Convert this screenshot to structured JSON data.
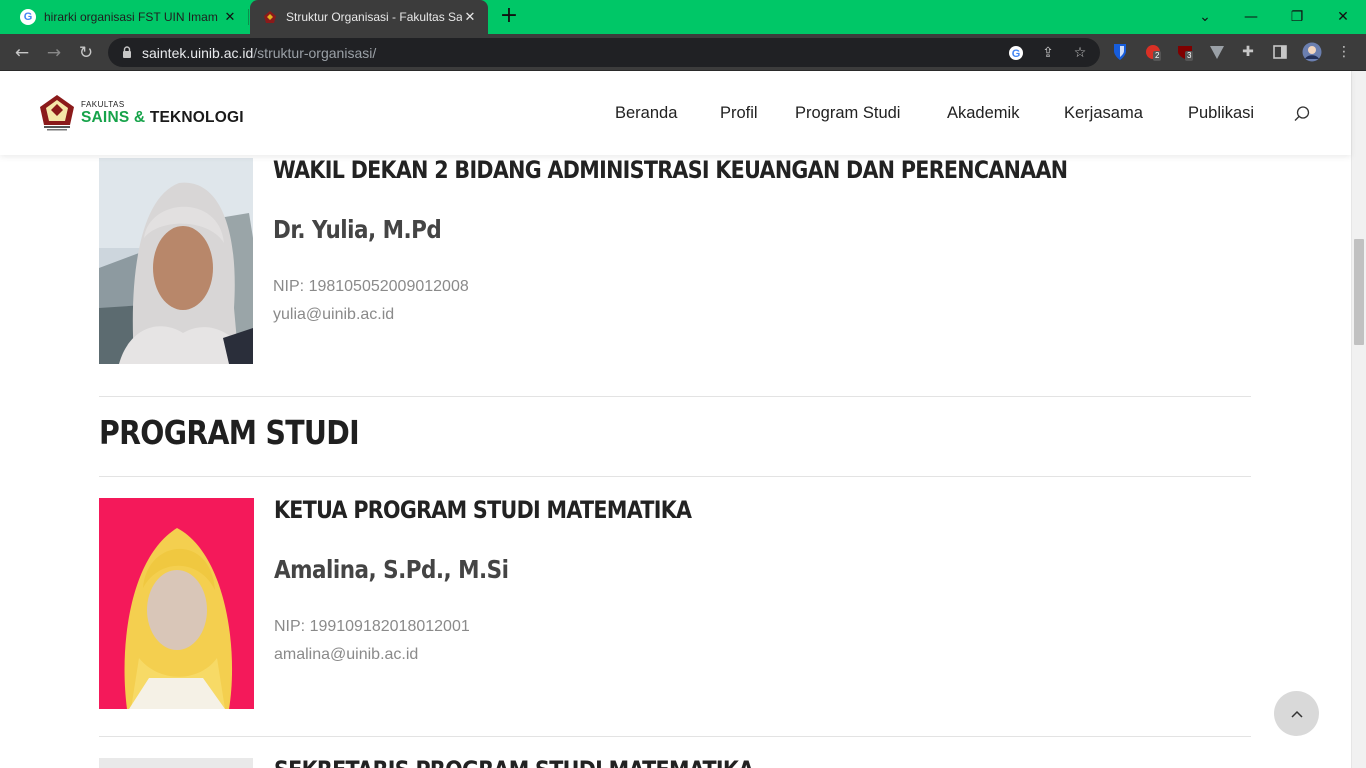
{
  "browser": {
    "tabs": [
      {
        "title": "hirarki organisasi FST UIN Imam Bonjol",
        "favicon": "google-g-icon"
      },
      {
        "title": "Struktur Organisasi - Fakultas Sains & Teknologi",
        "favicon": "uin-emblem-icon"
      }
    ],
    "url_host": "saintek.uinib.ac.id",
    "url_path": "/struktur-organisasi/",
    "extension_badges": {
      "ext_one": "2",
      "ext_two": "3"
    },
    "accent_color": "#00c767"
  },
  "site": {
    "logo": {
      "small": "FAKULTAS",
      "big_part1": "SAINS",
      "big_amp": "&",
      "big_part2": "TEKNOLOGI",
      "brand_color": "#16a34a"
    },
    "nav": [
      "Beranda",
      "Profil",
      "Program Studi",
      "Akademik",
      "Kerjasama",
      "Publikasi"
    ]
  },
  "content": {
    "wakil_dekan_2": {
      "role": "WAKIL DEKAN 2 BIDANG ADMINISTRASI KEUANGAN DAN PERENCANAAN",
      "name": "Dr. Yulia, M.Pd",
      "nip": "NIP: 198105052009012008",
      "email": "yulia@uinib.ac.id"
    },
    "section_title": "PROGRAM STUDI",
    "kaprodi_matematika": {
      "role": "KETUA PROGRAM STUDI MATEMATIKA",
      "name": "Amalina, S.Pd., M.Si",
      "nip": "NIP: 199109182018012001",
      "email": "amalina@uinib.ac.id"
    },
    "next_role_partial": "SEKRETARIS PROGRAM STUDI MATEMATIKA"
  }
}
